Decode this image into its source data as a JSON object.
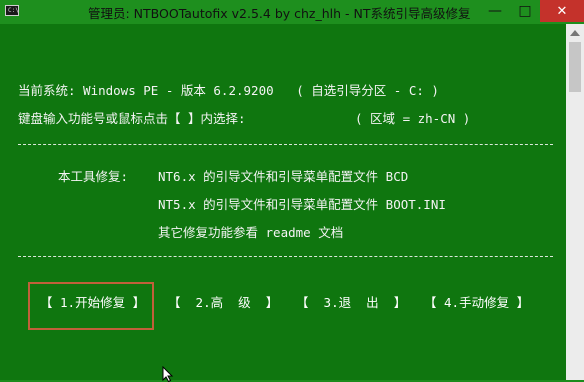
{
  "window": {
    "title": "管理员: NTBOOTautofix v2.5.4 by chz_hlh - NT系统引导高级修复",
    "icon_text": "C:\\",
    "controls": {
      "minimize": "—",
      "maximize": "□",
      "close": "✕"
    }
  },
  "console": {
    "current_system": "当前系统: Windows PE - 版本 6.2.9200   ( 自选引导分区 - C: )",
    "input_prompt": "键盘输入功能号或鼠标点击【 】内选择:",
    "region": "( 区域 = zh-CN )",
    "tool_repair_label": "本工具修复:",
    "repair_lines": [
      "NT6.x 的引导文件和引导菜单配置文件 BCD",
      "NT5.x 的引导文件和引导菜单配置文件 BOOT.INI",
      "其它修复功能参看 readme 文档"
    ],
    "menu": [
      "【 1.开始修复 】",
      "【  2.高  级  】",
      "【  3.退  出  】",
      "【 4.手动修复 】"
    ]
  },
  "colors": {
    "background": "#0f760f",
    "titlebar": "#1e8f1e",
    "close_button": "#c4322b",
    "selection_border": "#c0603a"
  }
}
